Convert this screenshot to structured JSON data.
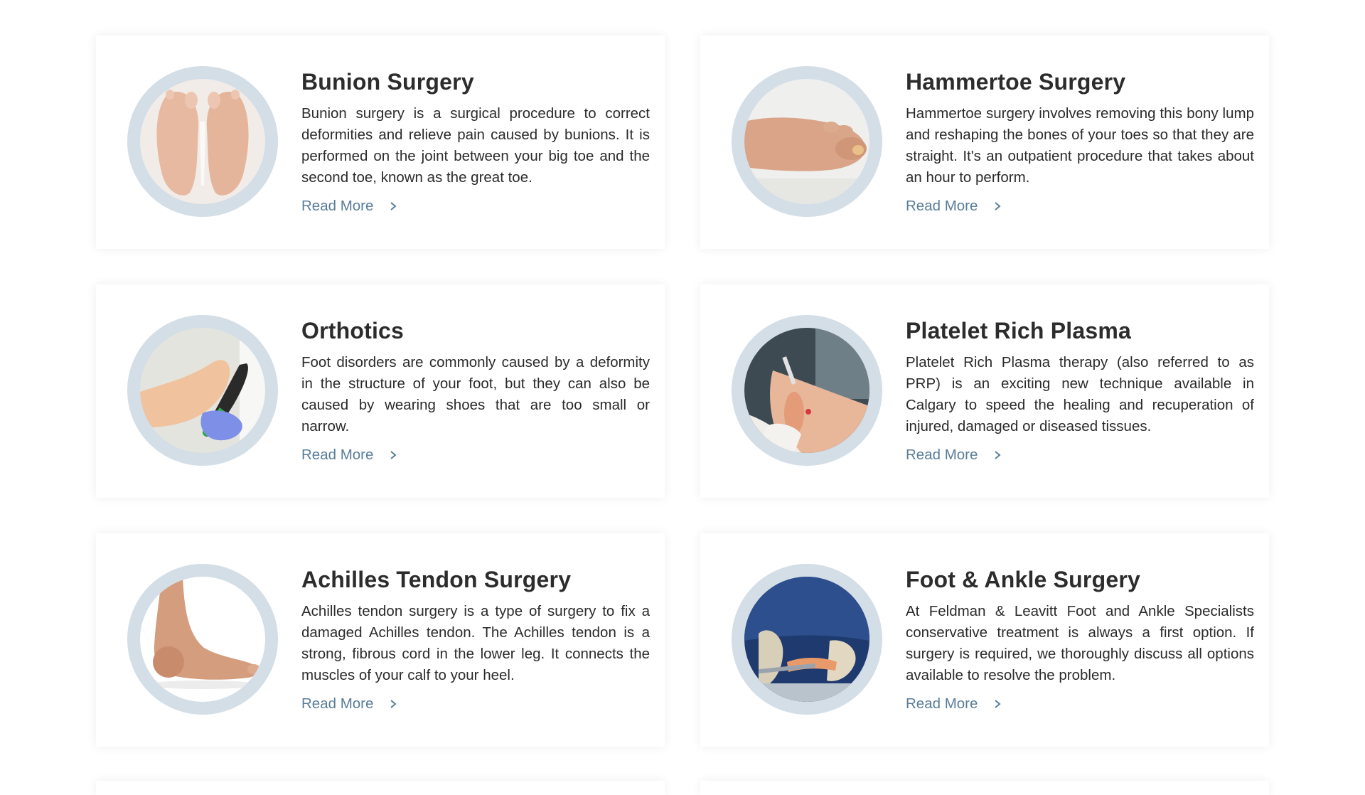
{
  "services": [
    {
      "title": "Bunion Surgery",
      "description": "Bunion surgery is a surgical procedure to correct deformities and relieve pain caused by bunions. It is performed on the joint between your big toe and the second toe, known as the great toe.",
      "link": "Read More",
      "image": "bunion-feet-photo"
    },
    {
      "title": "Hammertoe Surgery",
      "description": "Hammertoe surgery involves removing this bony lump and reshaping the bones of your toes so that they are straight. It's an outpatient procedure that takes about an hour to perform.",
      "link": "Read More",
      "image": "hammertoe-foot-photo"
    },
    {
      "title": "Orthotics",
      "description": "Foot disorders are commonly caused by a deformity in the structure of your foot, but they can also be caused by wearing shoes that are too small or narrow.",
      "link": "Read More",
      "image": "orthotic-insole-photo"
    },
    {
      "title": "Platelet Rich Plasma",
      "description": "Platelet Rich Plasma therapy (also referred to as PRP) is an exciting new technique available in Calgary to speed the healing and recuperation of injured, damaged or diseased tissues.",
      "link": "Read More",
      "image": "prp-injection-photo"
    },
    {
      "title": "Achilles Tendon Surgery",
      "description": "Achilles tendon surgery is a type of surgery to fix a damaged Achilles tendon. The Achilles tendon is a strong, fibrous cord in the lower leg. It connects the muscles of your calf to your heel.",
      "link": "Read More",
      "image": "achilles-foot-photo"
    },
    {
      "title": "Foot & Ankle Surgery",
      "description": "At Feldman & Leavitt Foot and Ankle Specialists conservative treatment is always a first option. If surgery is required, we thoroughly discuss all options available to resolve the problem.",
      "link": "Read More",
      "image": "surgery-operation-photo"
    }
  ],
  "colors": {
    "accent": "#5a7d98",
    "ring": "#d4dee7",
    "heading": "#2c2c2c",
    "text": "#2b2b2b"
  },
  "icons": {
    "link_arrow": "chevron-right-icon"
  }
}
